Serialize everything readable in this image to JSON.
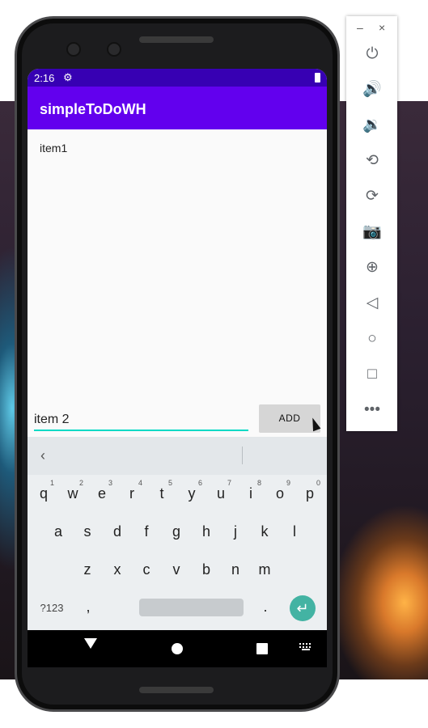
{
  "status_bar": {
    "time": "2:16",
    "settings_icon": "gear-icon",
    "battery_icon": "battery-icon"
  },
  "app_bar": {
    "title": "simpleToDoWH"
  },
  "todo_list": {
    "items": [
      "item1"
    ]
  },
  "new_item": {
    "value": "item 2",
    "add_label": "ADD"
  },
  "keyboard": {
    "suggestion_back_icon": "chevron-left-icon",
    "row1": [
      {
        "key": "q",
        "hint": "1"
      },
      {
        "key": "w",
        "hint": "2"
      },
      {
        "key": "e",
        "hint": "3"
      },
      {
        "key": "r",
        "hint": "4"
      },
      {
        "key": "t",
        "hint": "5"
      },
      {
        "key": "y",
        "hint": "6"
      },
      {
        "key": "u",
        "hint": "7"
      },
      {
        "key": "i",
        "hint": "8"
      },
      {
        "key": "o",
        "hint": "9"
      },
      {
        "key": "p",
        "hint": "0"
      }
    ],
    "row2": [
      "a",
      "s",
      "d",
      "f",
      "g",
      "h",
      "j",
      "k",
      "l"
    ],
    "row3": [
      "z",
      "x",
      "c",
      "v",
      "b",
      "n",
      "m"
    ],
    "row4": {
      "symbols": "?123",
      "comma": ",",
      "period": ".",
      "enter_icon": "enter-icon"
    }
  },
  "nav_bar": {
    "back_icon": "back-triangle-icon",
    "home_icon": "home-circle-icon",
    "recents_icon": "recents-square-icon",
    "keyboard_icon": "keyboard-icon"
  },
  "emulator_toolbar": {
    "window_controls": [
      "–",
      "×"
    ],
    "buttons": [
      "power-icon",
      "volume-up-icon",
      "volume-down-icon",
      "rotate-left-icon",
      "rotate-right-icon",
      "camera-icon",
      "zoom-icon",
      "back-icon",
      "home-icon",
      "overview-icon",
      "more-icon"
    ]
  },
  "colors": {
    "primary": "#6200ee",
    "primary_dark": "#3700b3",
    "accent": "#03dac5",
    "enter_key": "#43b3a3"
  }
}
